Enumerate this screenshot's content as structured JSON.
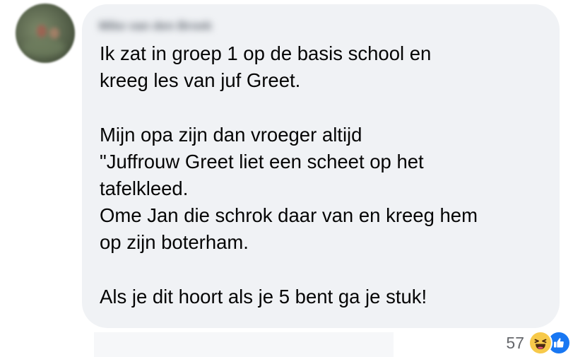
{
  "comment": {
    "author": "Mike van den Broek",
    "lines": [
      "Ik zat in groep 1 op de basis school en",
      "kreeg les van juf Greet.",
      "",
      "Mijn opa zijn dan vroeger altijd",
      "\"Juffrouw Greet liet een scheet op het",
      "tafelkleed.",
      "Ome Jan die schrok daar van en kreeg hem",
      "op zijn boterham.",
      "",
      "Als je dit hoort als je 5 bent ga je stuk!"
    ]
  },
  "reactions": {
    "count": "57",
    "icons": [
      "haha-icon",
      "like-icon"
    ],
    "colors": {
      "haha": "#f7c94a",
      "like": "#1877f2"
    }
  },
  "colors": {
    "bubble_background": "#f0f2f5",
    "text": "#050505",
    "secondary_text": "#65676b"
  }
}
